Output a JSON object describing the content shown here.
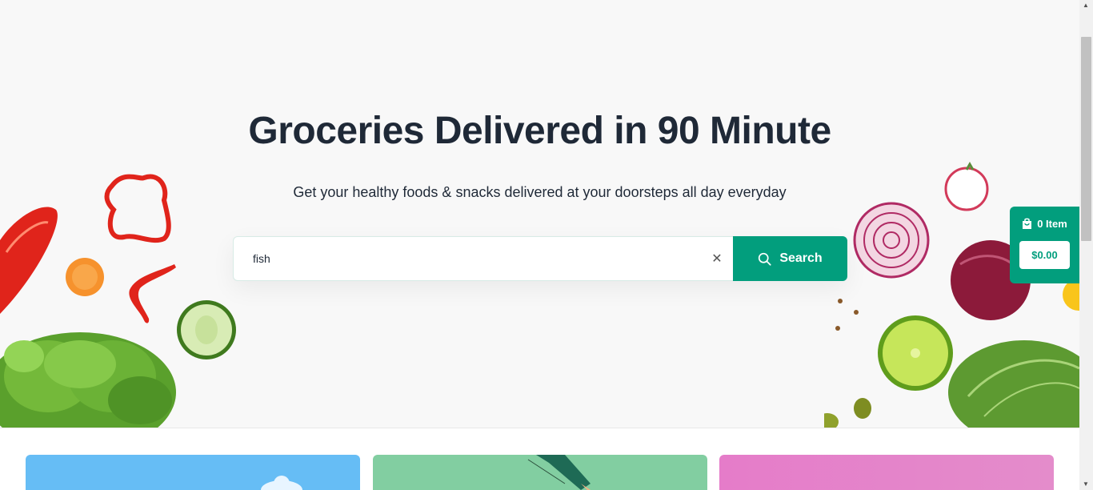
{
  "hero": {
    "title": "Groceries Delivered in 90 Minute",
    "subtitle": "Get your healthy foods & snacks delivered at your doorsteps all day everyday"
  },
  "search": {
    "value": "fish",
    "clear_icon": "close-icon",
    "button_label": "Search",
    "button_icon": "search-icon"
  },
  "cart": {
    "icon": "shopping-bag-icon",
    "count_label": "0 Item",
    "total": "$0.00"
  },
  "colors": {
    "accent": "#029e7d",
    "hero_bg": "#f8f8f8",
    "card_blue": "#66bdf5",
    "card_green": "#82cea1",
    "card_pink": "#e57cc9"
  },
  "promo_cards": [
    {
      "name": "promo-card-blue"
    },
    {
      "name": "promo-card-green"
    },
    {
      "name": "promo-card-pink"
    }
  ]
}
